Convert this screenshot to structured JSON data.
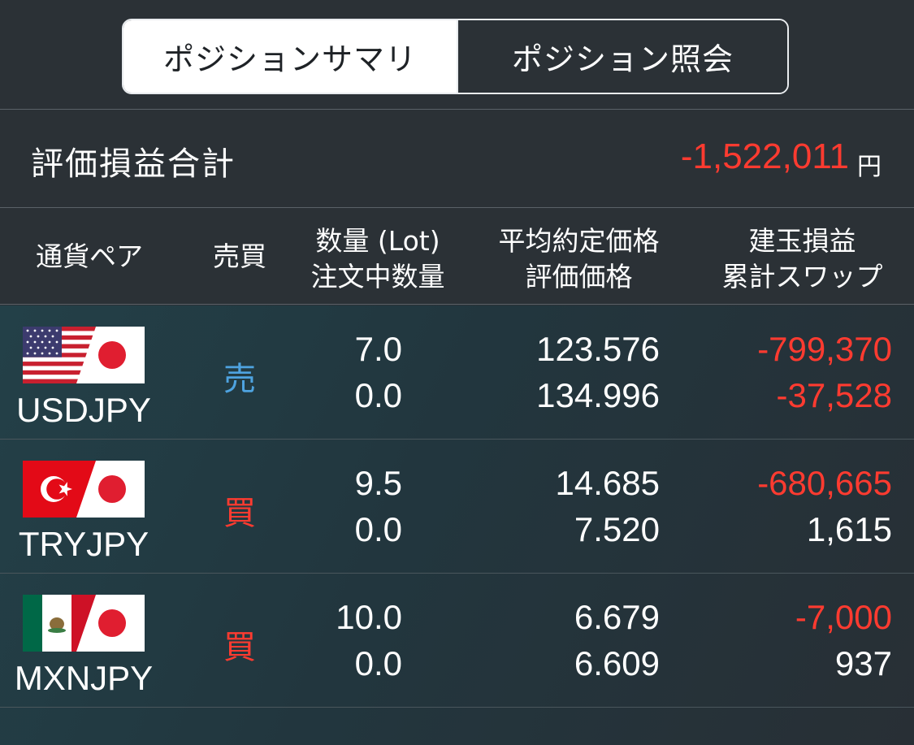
{
  "tabs": {
    "summary_label": "ポジションサマリ",
    "inquiry_label": "ポジション照会"
  },
  "total": {
    "label": "評価損益合計",
    "value": "-1,522,011",
    "unit": "円"
  },
  "headers": {
    "pair": "通貨ペア",
    "side": "売買",
    "qty_line1": "数量 (Lot)",
    "qty_line2": "注文中数量",
    "price_line1": "平均約定価格",
    "price_line2": "評価価格",
    "pl_line1": "建玉損益",
    "pl_line2": "累計スワップ"
  },
  "rows": [
    {
      "pair": "USDJPY",
      "side": "売",
      "qty": "7.0",
      "order_qty": "0.0",
      "avg_price": "123.576",
      "eval_price": "134.996",
      "pl": "-799,370",
      "swap": "-37,528",
      "flag": "us-jp-flag-icon"
    },
    {
      "pair": "TRYJPY",
      "side": "買",
      "qty": "9.5",
      "order_qty": "0.0",
      "avg_price": "14.685",
      "eval_price": "7.520",
      "pl": "-680,665",
      "swap": "1,615",
      "flag": "tr-jp-flag-icon"
    },
    {
      "pair": "MXNJPY",
      "side": "買",
      "qty": "10.0",
      "order_qty": "0.0",
      "avg_price": "6.679",
      "eval_price": "6.609",
      "pl": "-7,000",
      "swap": "937",
      "flag": "mx-jp-flag-icon"
    }
  ],
  "colors": {
    "negative": "#ff3b30",
    "sell": "#4ea3e0",
    "buy": "#ff3b30",
    "background": "#2b3136"
  }
}
